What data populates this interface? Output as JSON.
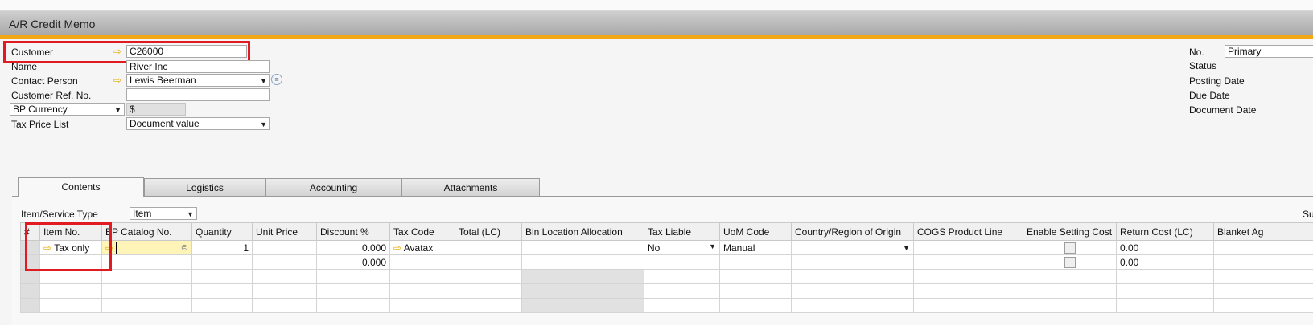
{
  "window": {
    "title": "A/R Credit Memo"
  },
  "header": {
    "customer": {
      "label": "Customer",
      "value": "C26000"
    },
    "name": {
      "label": "Name",
      "value": "River Inc"
    },
    "contact_person": {
      "label": "Contact Person",
      "value": "Lewis Beerman"
    },
    "customer_ref": {
      "label": "Customer Ref. No.",
      "value": ""
    },
    "bp_currency": {
      "label": "BP Currency",
      "value": "$"
    },
    "tax_price_list": {
      "label": "Tax Price List",
      "value": "Document value"
    }
  },
  "right_header": {
    "no": {
      "label": "No.",
      "value": "Primary"
    },
    "status": {
      "label": "Status"
    },
    "posting_date": {
      "label": "Posting Date"
    },
    "due_date": {
      "label": "Due Date"
    },
    "document_date": {
      "label": "Document Date"
    }
  },
  "tabs": [
    {
      "label": "Contents"
    },
    {
      "label": "Logistics"
    },
    {
      "label": "Accounting"
    },
    {
      "label": "Attachments"
    }
  ],
  "item_service_type": {
    "label": "Item/Service Type",
    "value": "Item"
  },
  "summary_label_partial": "Su",
  "table": {
    "columns": [
      "#",
      "Item No.",
      "BP Catalog No.",
      "Quantity",
      "Unit Price",
      "Discount %",
      "Tax Code",
      "Total (LC)",
      "Bin Location Allocation",
      "Tax Liable",
      "UoM Code",
      "Country/Region of Origin",
      "COGS Product Line",
      "Enable Setting Cost",
      "Return Cost (LC)",
      "Blanket Ag"
    ],
    "rows": [
      {
        "item_no": "Tax only",
        "quantity": "1",
        "discount": "0.000",
        "tax_code": "Avatax",
        "tax_liable": "No",
        "uom": "Manual",
        "return_cost": "0.00"
      },
      {
        "item_no": "",
        "quantity": "",
        "discount": "0.000",
        "tax_code": "",
        "tax_liable": "",
        "uom": "",
        "return_cost": "0.00"
      }
    ]
  },
  "colors": {
    "accent_orange": "#f2a716",
    "highlight_red": "#e11b22",
    "arrow_yellow": "#e6a800"
  }
}
